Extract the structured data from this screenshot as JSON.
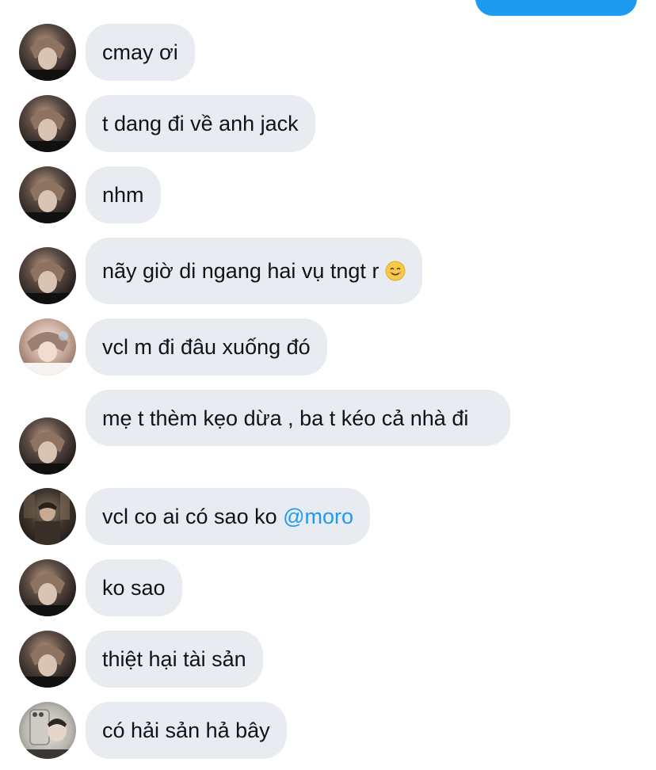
{
  "colors": {
    "bubble_background": "#e8ecf0",
    "sent_bubble": "#1d9bf0",
    "mention": "#1d9bf0",
    "text": "#0f1419"
  },
  "messages": [
    {
      "text": "cmay ơi",
      "avatar": "avatar-a"
    },
    {
      "text": "t dang đi về anh jack",
      "avatar": "avatar-a"
    },
    {
      "text": "nhm",
      "avatar": "avatar-a"
    },
    {
      "text": "nãy giờ di ngang hai vụ tngt r",
      "emoji": "smiling-face-emoji",
      "avatar": "avatar-a"
    },
    {
      "text": "vcl m đi đâu xuống đó",
      "avatar": "avatar-b"
    },
    {
      "text": "mẹ t thèm kẹo dừa , ba t kéo cả nhà đi",
      "avatar": "avatar-a"
    },
    {
      "text": "vcl co ai có sao ko ",
      "mention": "@moro",
      "avatar": "avatar-c"
    },
    {
      "text": "ko sao",
      "avatar": "avatar-a"
    },
    {
      "text": "thiệt hại tài sản",
      "avatar": "avatar-a"
    },
    {
      "text": "có hải sản hả bây",
      "avatar": "avatar-d"
    }
  ]
}
